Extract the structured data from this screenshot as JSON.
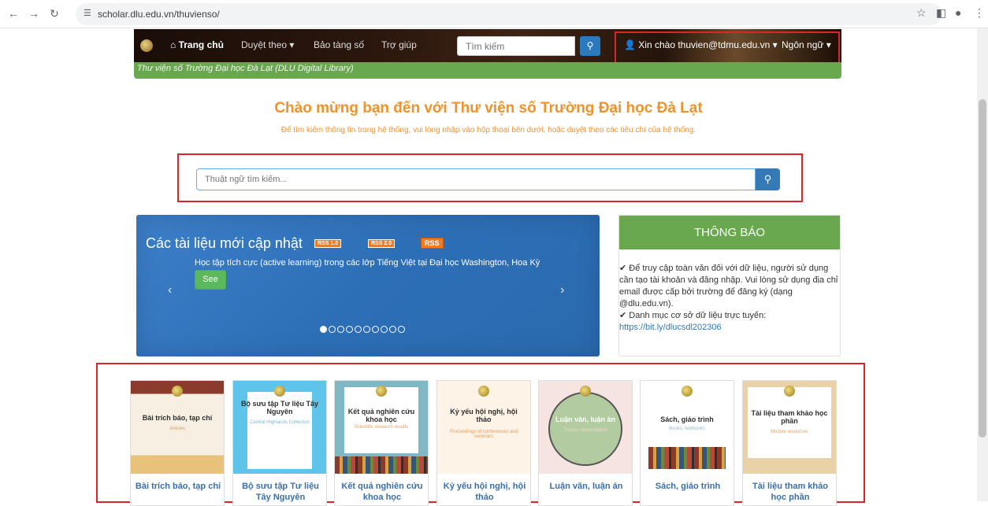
{
  "browser": {
    "url": "scholar.dlu.edu.vn/thuvienso/"
  },
  "nav": {
    "home": "Trang chủ",
    "browse": "Duyệt theo",
    "museum": "Bảo tàng số",
    "help": "Trợ giúp",
    "search_placeholder": "Tìm kiếm",
    "greeting": "Xin chào thuvien@tdmu.edu.vn",
    "language": "Ngôn ngữ"
  },
  "strip_text": "Thư viện số Trường Đại học Đà Lạt (DLU Digital Library)",
  "title": "Chào mừng bạn đến với Thư viện số Trường Đại học Đà Lạt",
  "subtitle": "Để tìm kiếm thông tin trong hệ thống, vui lòng nhập vào hộp thoại bên dưới, hoặc duyệt theo các tiêu chí của hệ thống.",
  "search": {
    "placeholder": "Thuật ngữ tìm kiếm..."
  },
  "carousel": {
    "title": "Các tài liệu mới cập nhật",
    "rss1": "RSS 1.0",
    "rss2": "RSS 2.0",
    "rss3": "RSS",
    "item_text": "Học tập tích cực (active learning) trong các lớp Tiếng Việt tại Đại học Washington, Hoa Kỳ",
    "see": "See",
    "prev": "‹",
    "next": "›"
  },
  "notice": {
    "title": "THÔNG BÁO",
    "line1": "✔ Để truy cập toàn văn đối với dữ liệu, người sử dụng cần tạo tài khoản và đăng nhập. Vui lòng sử dụng địa chỉ email được cấp bởi trường để đăng ký (dạng @dlu.edu.vn).",
    "line2": "✔ Danh mục cơ sở dữ liệu trực tuyến:",
    "link": "https://bit.ly/dlucsdl202306"
  },
  "collections": [
    {
      "thumb_title": "Bài trích báo, tạp chí",
      "thumb_sub": "Articles",
      "label": "Bài trích báo, tạp chí"
    },
    {
      "thumb_title": "Bộ sưu tập Tư liệu Tây Nguyên",
      "thumb_sub": "Central Highlands Collection",
      "label": "Bộ sưu tập Tư liệu Tây Nguyên"
    },
    {
      "thumb_title": "Kết quả nghiên cứu khoa học",
      "thumb_sub": "Scientific research results",
      "label": "Kết quả nghiên cứu khoa học"
    },
    {
      "thumb_title": "Kỷ yếu hội nghị, hội thảo",
      "thumb_sub": "Proceedings of conferences and seminars",
      "label": "Kỷ yếu hội nghị, hội thảo"
    },
    {
      "thumb_title": "Luận văn, luận án",
      "thumb_sub": "Thesis, dissertations",
      "label": "Luận văn, luận án"
    },
    {
      "thumb_title": "Sách, giáo trình",
      "thumb_sub": "Books, textbooks",
      "label": "Sách, giáo trình"
    },
    {
      "thumb_title": "Tài liệu tham khảo học phần",
      "thumb_sub": "Module resources",
      "label": "Tài liệu tham khảo học phần"
    }
  ]
}
